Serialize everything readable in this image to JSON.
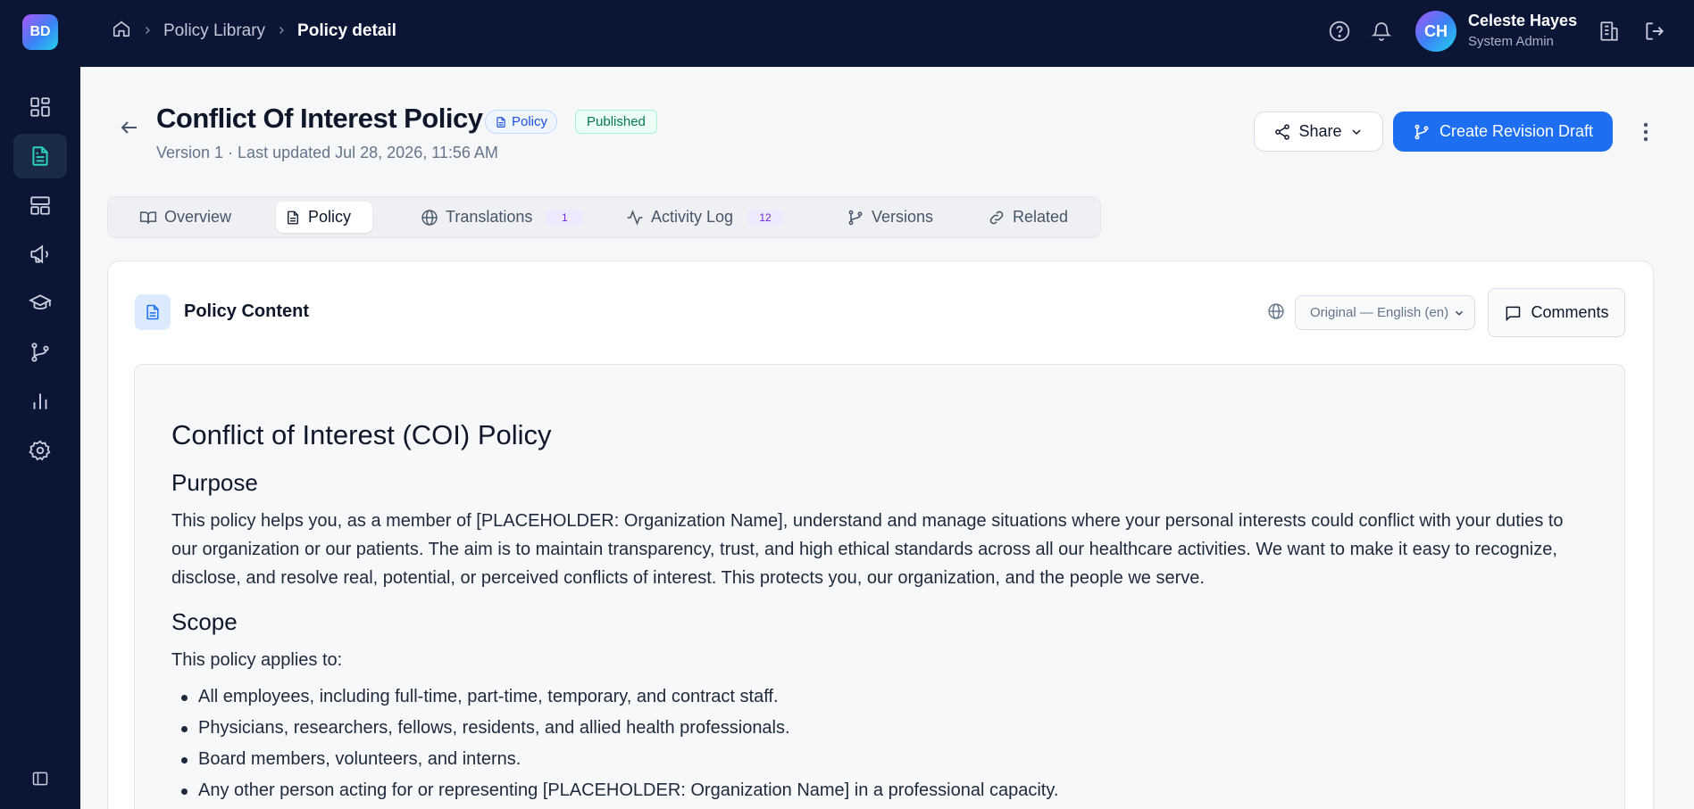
{
  "app": {
    "logo_initials": "BD"
  },
  "breadcrumb": {
    "items": [
      "Policy Library",
      "Policy detail"
    ]
  },
  "user": {
    "initials": "CH",
    "name": "Celeste Hayes",
    "role": "System Admin"
  },
  "sidebar": {
    "items": [
      {
        "name": "dashboard",
        "icon": "dashboard-icon"
      },
      {
        "name": "policies",
        "icon": "document-icon",
        "active": true
      },
      {
        "name": "templates",
        "icon": "layout-icon"
      },
      {
        "name": "announcements",
        "icon": "megaphone-icon"
      },
      {
        "name": "training",
        "icon": "graduation-cap-icon"
      },
      {
        "name": "workflows",
        "icon": "git-branch-icon"
      },
      {
        "name": "reports",
        "icon": "bar-chart-icon"
      },
      {
        "name": "settings",
        "icon": "gear-icon"
      }
    ]
  },
  "page": {
    "title": "Conflict Of Interest Policy",
    "type_badge": "Policy",
    "status_badge": "Published",
    "meta": "Version 1 · Last updated Jul 28, 2026, 11:56 AM",
    "share_label": "Share",
    "revision_label": "Create Revision Draft"
  },
  "tabs": [
    {
      "label": "Overview",
      "icon": "book-open-icon"
    },
    {
      "label": "Policy",
      "icon": "document-icon",
      "active": true
    },
    {
      "label": "Translations",
      "icon": "globe-icon",
      "count": "1"
    },
    {
      "label": "Activity Log",
      "icon": "activity-icon",
      "count": "12"
    },
    {
      "label": "Versions",
      "icon": "git-branch-icon"
    },
    {
      "label": "Related",
      "icon": "link-icon"
    }
  ],
  "content_card": {
    "title": "Policy Content",
    "language_selected": "Original — English (en)",
    "comments_label": "Comments"
  },
  "document": {
    "heading": "Conflict of Interest (COI) Policy",
    "purpose_heading": "Purpose",
    "purpose_text": "This policy helps you, as a member of [PLACEHOLDER: Organization Name], understand and manage situations where your personal interests could conflict with your duties to our organization or our patients. The aim is to maintain transparency, trust, and high ethical standards across all our healthcare activities. We want to make it easy to recognize, disclose, and resolve real, potential, or perceived conflicts of interest. This protects you, our organization, and the people we serve.",
    "scope_heading": "Scope",
    "scope_intro": "This policy applies to:",
    "scope_items": [
      "All employees, including full-time, part-time, temporary, and contract staff.",
      "Physicians, researchers, fellows, residents, and allied health professionals.",
      "Board members, volunteers, and interns.",
      "Any other person acting for or representing [PLACEHOLDER: Organization Name] in a professional capacity."
    ]
  },
  "colors": {
    "sidebar_bg": "#0b1535",
    "primary": "#1d6ef0",
    "published": "#047857",
    "accent_teal": "#2dd4bf"
  }
}
